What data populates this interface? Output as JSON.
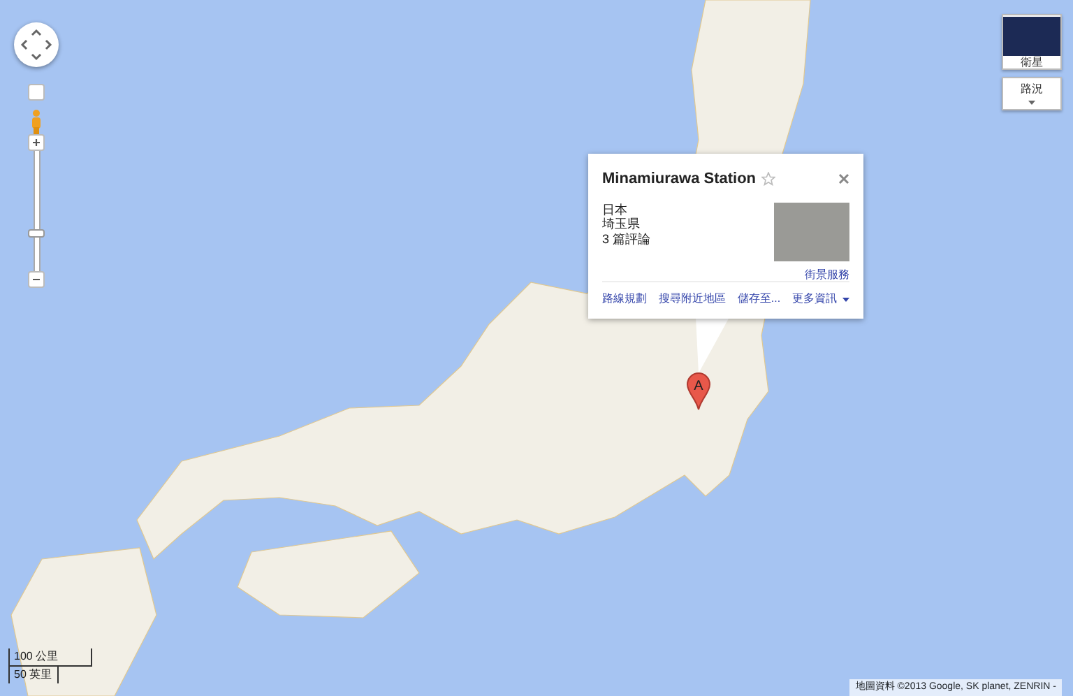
{
  "map_type_buttons": [
    {
      "label": "衛星",
      "kind": "thumbnail"
    },
    {
      "label": "路況",
      "kind": "dropdown"
    }
  ],
  "info_window": {
    "title": "Minamiurawa Station",
    "lines": [
      "日本",
      "埼玉県"
    ],
    "reviews": "3 篇評論",
    "photo_link": "街景服務",
    "actions": [
      {
        "label": "路線規劃",
        "kind": "link"
      },
      {
        "label": "搜尋附近地區",
        "kind": "link"
      },
      {
        "label": "儲存至...",
        "kind": "link"
      },
      {
        "label": "更多資訊",
        "kind": "menu"
      }
    ]
  },
  "marker": {
    "label": "A"
  },
  "scale": {
    "metric": "100 公里",
    "imperial": "50 英里"
  },
  "footer": "地圖資料 ©2013 Google, SK planet, ZENRIN -"
}
